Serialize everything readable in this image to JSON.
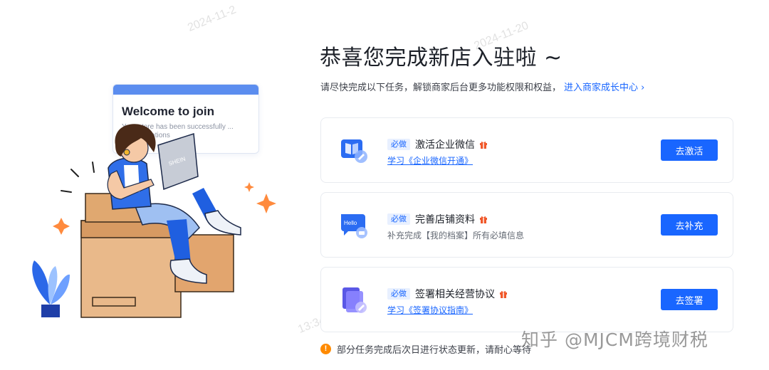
{
  "illustration": {
    "welcome_title": "Welcome to join",
    "welcome_body": "Your store has been successfully ... congratulations",
    "laptop_brand": "SHEIN",
    "bubble_text": "Hello"
  },
  "header": {
    "title": "恭喜您完成新店入驻啦 ~",
    "subtitle": "请尽快完成以下任务，解锁商家后台更多功能权限和权益，",
    "growth_link": "进入商家成长中心 ›"
  },
  "tasks": [
    {
      "badge": "必做",
      "name": "激活企业微信",
      "detail": "学习《企业微信开通》",
      "detail_is_link": true,
      "button": "去激活",
      "icon": "book-icon"
    },
    {
      "badge": "必做",
      "name": "完善店铺资料",
      "detail": "补充完成【我的档案】所有必填信息",
      "detail_is_link": false,
      "button": "去补充",
      "icon": "chat-bubble-icon"
    },
    {
      "badge": "必做",
      "name": "签署相关经营协议",
      "detail": "学习《签署协议指南》",
      "detail_is_link": true,
      "button": "去签署",
      "icon": "document-sign-icon"
    }
  ],
  "notice": {
    "icon": "!",
    "text": "部分任务完成后次日进行状态更新，请耐心等待"
  },
  "watermark": {
    "text": "知乎 @MJCM跨境财税"
  },
  "stamps": [
    "2024-11-2",
    "2024-11-20",
    "13:34"
  ],
  "colors": {
    "primary": "#1966ff",
    "badge_bg": "#e8f0ff",
    "gift": "#f0582a",
    "notice": "#ff8a00"
  }
}
